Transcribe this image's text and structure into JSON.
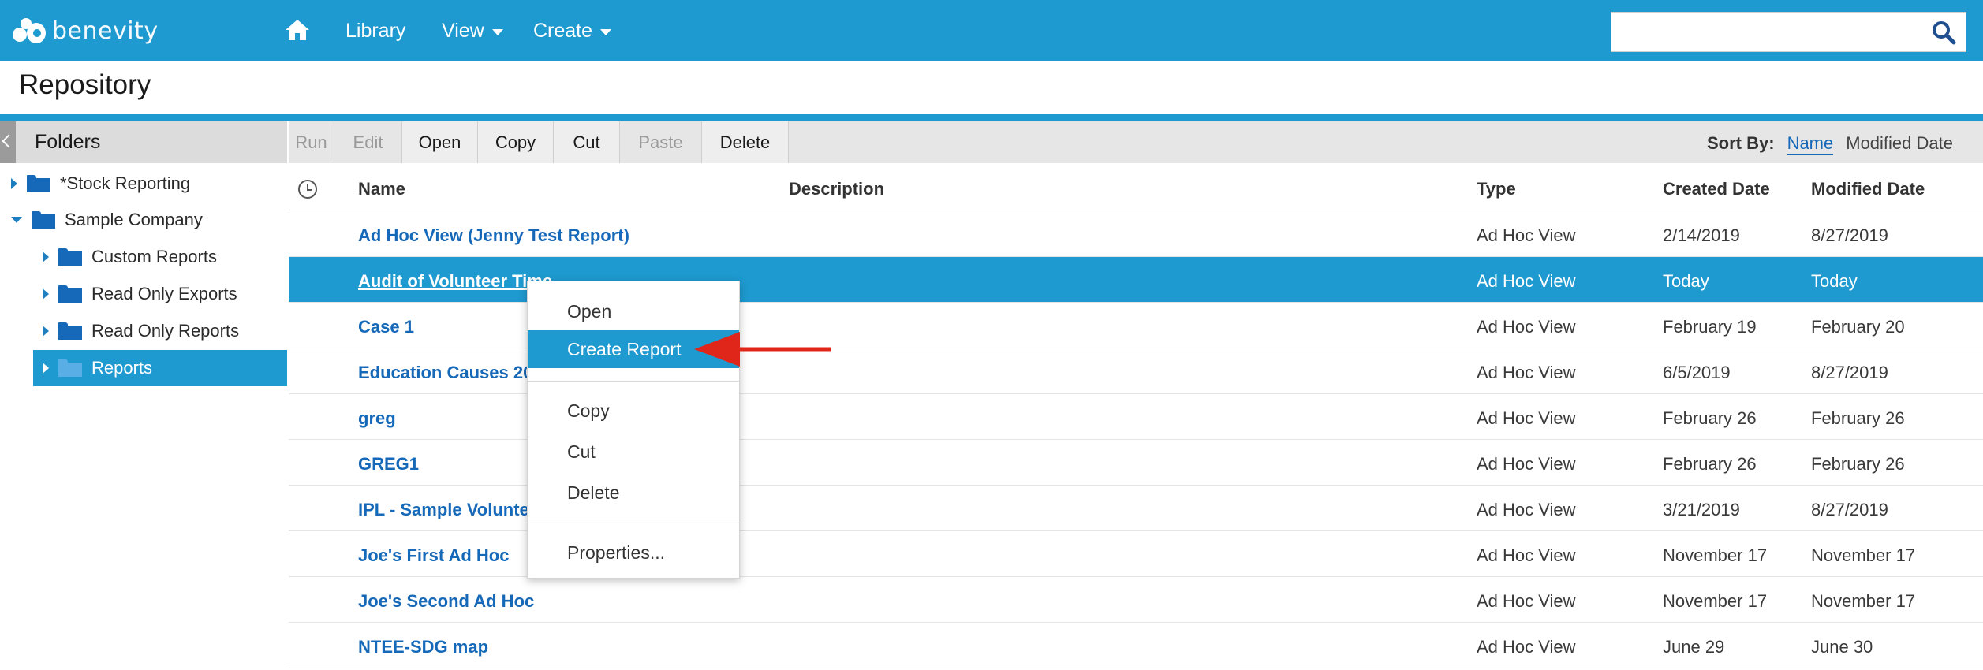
{
  "app": {
    "brand": "benevity",
    "nav": {
      "home_icon": "home-icon",
      "items": [
        {
          "label": "Library",
          "has_dropdown": false
        },
        {
          "label": "View",
          "has_dropdown": true
        },
        {
          "label": "Create",
          "has_dropdown": true
        }
      ]
    },
    "search": {
      "value": "",
      "placeholder": "",
      "icon": "search-icon"
    }
  },
  "page": {
    "title": "Repository"
  },
  "folders": {
    "title": "Folders",
    "items": [
      {
        "label": "*Stock Reporting",
        "level": 0,
        "expanded": false,
        "selected": false
      },
      {
        "label": "Sample Company",
        "level": 0,
        "expanded": true,
        "selected": false
      },
      {
        "label": "Custom Reports",
        "level": 1,
        "expanded": false,
        "selected": false
      },
      {
        "label": "Read Only Exports",
        "level": 1,
        "expanded": false,
        "selected": false
      },
      {
        "label": "Read Only Reports",
        "level": 1,
        "expanded": false,
        "selected": false
      },
      {
        "label": "Reports",
        "level": 1,
        "expanded": false,
        "selected": true
      }
    ]
  },
  "toolbar": {
    "buttons": [
      {
        "label": "Run",
        "enabled": false
      },
      {
        "label": "Edit",
        "enabled": false
      },
      {
        "label": "Open",
        "enabled": true
      },
      {
        "label": "Copy",
        "enabled": true
      },
      {
        "label": "Cut",
        "enabled": true
      },
      {
        "label": "Paste",
        "enabled": false
      },
      {
        "label": "Delete",
        "enabled": true
      }
    ],
    "sort": {
      "label": "Sort By:",
      "options": [
        "Name",
        "Modified Date"
      ],
      "active": "Name"
    }
  },
  "table": {
    "columns": {
      "name": "Name",
      "description": "Description",
      "type": "Type",
      "created": "Created Date",
      "modified": "Modified Date"
    },
    "rows": [
      {
        "name": "Ad Hoc View (Jenny Test Report)",
        "type": "Ad Hoc View",
        "created": "2/14/2019",
        "modified": "8/27/2019",
        "selected": false
      },
      {
        "name": "Audit of Volunteer Time",
        "type": "Ad Hoc View",
        "created": "Today",
        "modified": "Today",
        "selected": true
      },
      {
        "name": "Case 1",
        "type": "Ad Hoc View",
        "created": "February 19",
        "modified": "February 20",
        "selected": false
      },
      {
        "name": "Education Causes 201",
        "type": "Ad Hoc View",
        "created": "6/5/2019",
        "modified": "8/27/2019",
        "selected": false
      },
      {
        "name": "greg",
        "type": "Ad Hoc View",
        "created": "February 26",
        "modified": "February 26",
        "selected": false
      },
      {
        "name": "GREG1",
        "type": "Ad Hoc View",
        "created": "February 26",
        "modified": "February 26",
        "selected": false
      },
      {
        "name": "IPL - Sample Voluntee",
        "type": "Ad Hoc View",
        "created": "3/21/2019",
        "modified": "8/27/2019",
        "selected": false
      },
      {
        "name": "Joe's First Ad Hoc",
        "type": "Ad Hoc View",
        "created": "November 17",
        "modified": "November 17",
        "selected": false
      },
      {
        "name": "Joe's Second Ad Hoc",
        "type": "Ad Hoc View",
        "created": "November 17",
        "modified": "November 17",
        "selected": false
      },
      {
        "name": "NTEE-SDG map",
        "type": "Ad Hoc View",
        "created": "June 29",
        "modified": "June 30",
        "selected": false
      }
    ]
  },
  "context_menu": {
    "items": [
      "Open",
      "Create Report",
      "Copy",
      "Cut",
      "Delete",
      "Properties..."
    ],
    "active": "Create Report"
  },
  "colors": {
    "brand_blue": "#1e9ad0",
    "link_blue": "#1669b8",
    "annotation_red": "#e0251b"
  }
}
